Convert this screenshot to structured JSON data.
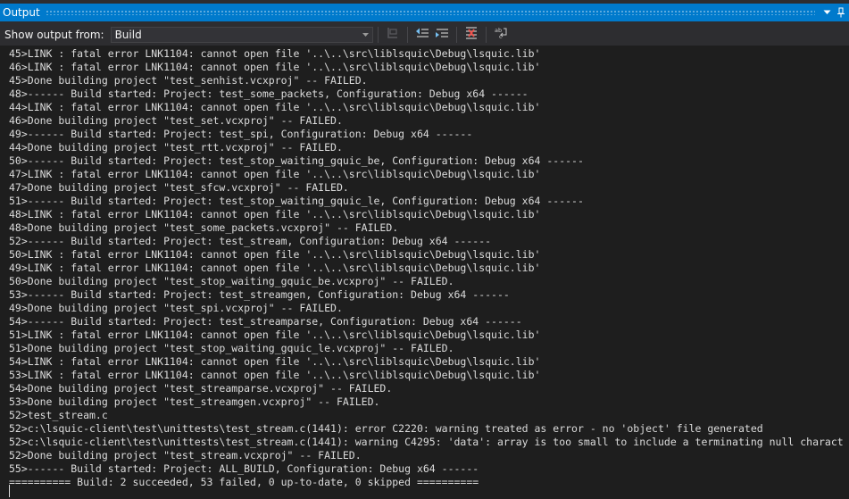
{
  "panel": {
    "title": "Output"
  },
  "toolbar": {
    "show_output_label": "Show output from:",
    "source_value": "Build"
  },
  "icons": {
    "title_dropdown": "chevron-down-icon",
    "title_pin": "pin-icon",
    "title_close": "close-icon",
    "find_message": "find-message-in-code-icon",
    "prev_message": "go-to-previous-message-icon",
    "next_message": "go-to-next-message-icon",
    "clear": "clear-all-icon",
    "word_wrap": "toggle-word-wrap-icon"
  },
  "colors": {
    "accent": "#007acc",
    "background": "#1e1e1e",
    "text": "#dcdcdc"
  },
  "output_lines": [
    "45>LINK : fatal error LNK1104: cannot open file '..\\..\\src\\liblsquic\\Debug\\lsquic.lib'",
    "46>LINK : fatal error LNK1104: cannot open file '..\\..\\src\\liblsquic\\Debug\\lsquic.lib'",
    "45>Done building project \"test_senhist.vcxproj\" -- FAILED.",
    "48>------ Build started: Project: test_some_packets, Configuration: Debug x64 ------",
    "44>LINK : fatal error LNK1104: cannot open file '..\\..\\src\\liblsquic\\Debug\\lsquic.lib'",
    "46>Done building project \"test_set.vcxproj\" -- FAILED.",
    "49>------ Build started: Project: test_spi, Configuration: Debug x64 ------",
    "44>Done building project \"test_rtt.vcxproj\" -- FAILED.",
    "50>------ Build started: Project: test_stop_waiting_gquic_be, Configuration: Debug x64 ------",
    "47>LINK : fatal error LNK1104: cannot open file '..\\..\\src\\liblsquic\\Debug\\lsquic.lib'",
    "47>Done building project \"test_sfcw.vcxproj\" -- FAILED.",
    "51>------ Build started: Project: test_stop_waiting_gquic_le, Configuration: Debug x64 ------",
    "48>LINK : fatal error LNK1104: cannot open file '..\\..\\src\\liblsquic\\Debug\\lsquic.lib'",
    "48>Done building project \"test_some_packets.vcxproj\" -- FAILED.",
    "52>------ Build started: Project: test_stream, Configuration: Debug x64 ------",
    "50>LINK : fatal error LNK1104: cannot open file '..\\..\\src\\liblsquic\\Debug\\lsquic.lib'",
    "49>LINK : fatal error LNK1104: cannot open file '..\\..\\src\\liblsquic\\Debug\\lsquic.lib'",
    "50>Done building project \"test_stop_waiting_gquic_be.vcxproj\" -- FAILED.",
    "53>------ Build started: Project: test_streamgen, Configuration: Debug x64 ------",
    "49>Done building project \"test_spi.vcxproj\" -- FAILED.",
    "54>------ Build started: Project: test_streamparse, Configuration: Debug x64 ------",
    "51>LINK : fatal error LNK1104: cannot open file '..\\..\\src\\liblsquic\\Debug\\lsquic.lib'",
    "51>Done building project \"test_stop_waiting_gquic_le.vcxproj\" -- FAILED.",
    "54>LINK : fatal error LNK1104: cannot open file '..\\..\\src\\liblsquic\\Debug\\lsquic.lib'",
    "53>LINK : fatal error LNK1104: cannot open file '..\\..\\src\\liblsquic\\Debug\\lsquic.lib'",
    "54>Done building project \"test_streamparse.vcxproj\" -- FAILED.",
    "53>Done building project \"test_streamgen.vcxproj\" -- FAILED.",
    "52>test_stream.c",
    "52>c:\\lsquic-client\\test\\unittests\\test_stream.c(1441): error C2220: warning treated as error - no 'object' file generated",
    "52>c:\\lsquic-client\\test\\unittests\\test_stream.c(1441): warning C4295: 'data': array is too small to include a terminating null charact",
    "52>Done building project \"test_stream.vcxproj\" -- FAILED.",
    "55>------ Build started: Project: ALL_BUILD, Configuration: Debug x64 ------",
    "========== Build: 2 succeeded, 53 failed, 0 up-to-date, 0 skipped =========="
  ]
}
